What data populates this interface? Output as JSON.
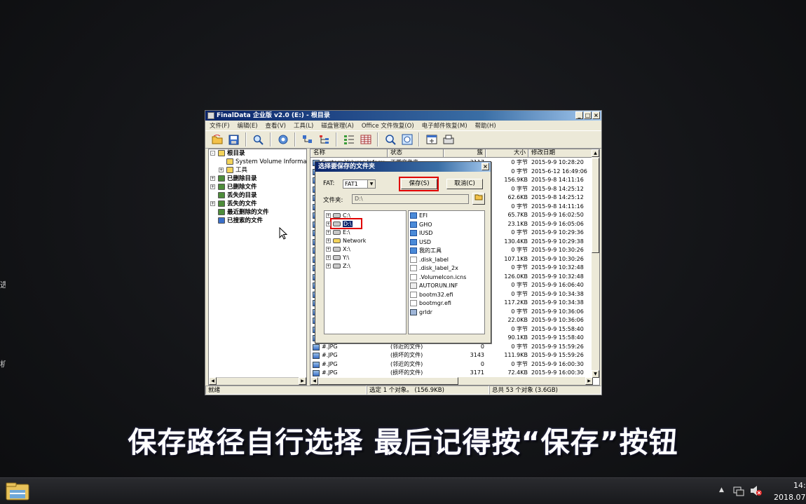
{
  "edge_labels": [
    "选",
    "机"
  ],
  "window": {
    "title": "FinalData 企业版 v2.0 (E:) - 根目录",
    "buttons": [
      "_",
      "□",
      "×"
    ]
  },
  "menu": [
    "文件(F)",
    "编辑(E)",
    "查看(V)",
    "工具(L)",
    "磁盘管理(A)",
    "Office 文件恢复(O)",
    "电子邮件恢复(M)",
    "帮助(H)"
  ],
  "toolbar_icons": [
    "open-folder-icon",
    "save-icon",
    "search-icon",
    "settings-icon",
    "copy-icon",
    "tree-icon",
    "list-view-icon",
    "grid-view-icon",
    "find-icon",
    "compare-icon",
    "add-window-icon",
    "scan-icon"
  ],
  "tree": [
    {
      "label": "根目录",
      "bold": true,
      "indent": 0,
      "exp": "-",
      "icon": "folder"
    },
    {
      "label": "System Volume Information",
      "bold": false,
      "indent": 1,
      "exp": "",
      "icon": "folder"
    },
    {
      "label": "工具",
      "bold": false,
      "indent": 1,
      "exp": "+",
      "icon": "folder"
    },
    {
      "label": "已删除目录",
      "bold": true,
      "indent": 0,
      "exp": "+",
      "icon": "deleted"
    },
    {
      "label": "已删除文件",
      "bold": true,
      "indent": 0,
      "exp": "+",
      "icon": "deleted"
    },
    {
      "label": "丢失的目录",
      "bold": true,
      "indent": 0,
      "exp": "",
      "icon": "deleted"
    },
    {
      "label": "丢失的文件",
      "bold": true,
      "indent": 0,
      "exp": "+",
      "icon": "deleted"
    },
    {
      "label": "最近删除的文件",
      "bold": true,
      "indent": 0,
      "exp": "",
      "icon": "deleted"
    },
    {
      "label": "已搜索的文件",
      "bold": true,
      "indent": 0,
      "exp": "",
      "icon": "search"
    }
  ],
  "list": {
    "columns": [
      "名称",
      "状态",
      "簇",
      "大小",
      "修改日期"
    ],
    "rows": [
      {
        "name": "System Volume Informa",
        "status": "正常文件夹",
        "cluster": "3117",
        "size": "0 字节",
        "date": "2015-9-9 10:28:20"
      },
      {
        "name": "",
        "status": "",
        "cluster": "",
        "size": "0 字节",
        "date": "2015-6-12 16:49:06"
      },
      {
        "name": "",
        "status": "",
        "cluster": "",
        "size": "156.9KB",
        "date": "2015-9-8 14:11:16"
      },
      {
        "name": "",
        "status": "",
        "cluster": "",
        "size": "0 字节",
        "date": "2015-9-8 14:25:12"
      },
      {
        "name": "",
        "status": "",
        "cluster": "",
        "size": "62.6KB",
        "date": "2015-9-8 14:25:12"
      },
      {
        "name": "",
        "status": "",
        "cluster": "",
        "size": "0 字节",
        "date": "2015-9-8 14:11:16"
      },
      {
        "name": "",
        "status": "",
        "cluster": "",
        "size": "65.7KB",
        "date": "2015-9-9 16:02:50"
      },
      {
        "name": "",
        "status": "",
        "cluster": "",
        "size": "23.1KB",
        "date": "2015-9-9 16:05:06"
      },
      {
        "name": "",
        "status": "",
        "cluster": "",
        "size": "0 字节",
        "date": "2015-9-9 10:29:36"
      },
      {
        "name": "",
        "status": "",
        "cluster": "",
        "size": "130.4KB",
        "date": "2015-9-9 10:29:38"
      },
      {
        "name": "",
        "status": "",
        "cluster": "",
        "size": "0 字节",
        "date": "2015-9-9 10:30:26"
      },
      {
        "name": "",
        "status": "",
        "cluster": "",
        "size": "107.1KB",
        "date": "2015-9-9 10:30:26"
      },
      {
        "name": "",
        "status": "",
        "cluster": "",
        "size": "0 字节",
        "date": "2015-9-9 10:32:48"
      },
      {
        "name": "",
        "status": "",
        "cluster": "",
        "size": "126.0KB",
        "date": "2015-9-9 10:32:48"
      },
      {
        "name": "",
        "status": "",
        "cluster": "",
        "size": "0 字节",
        "date": "2015-9-9 16:06:40"
      },
      {
        "name": "",
        "status": "",
        "cluster": "",
        "size": "0 字节",
        "date": "2015-9-9 10:34:38"
      },
      {
        "name": "",
        "status": "",
        "cluster": "",
        "size": "117.2KB",
        "date": "2015-9-9 10:34:38"
      },
      {
        "name": "",
        "status": "",
        "cluster": "",
        "size": "0 字节",
        "date": "2015-9-9 10:36:06"
      },
      {
        "name": "",
        "status": "",
        "cluster": "",
        "size": "22.0KB",
        "date": "2015-9-9 10:36:06"
      },
      {
        "name": "",
        "status": "",
        "cluster": "",
        "size": "0 字节",
        "date": "2015-9-9 15:58:40"
      },
      {
        "name": "",
        "status": "",
        "cluster": "",
        "size": "90.1KB",
        "date": "2015-9-9 15:58:40"
      },
      {
        "name": "#.JPG",
        "status": "(邻近的文件)",
        "cluster": "0",
        "size": "0 字节",
        "date": "2015-9-9 15:59:26"
      },
      {
        "name": "#.JPG",
        "status": "(损坏的文件)",
        "cluster": "3143",
        "size": "111.9KB",
        "date": "2015-9-9 15:59:26"
      },
      {
        "name": "#.JPG",
        "status": "(邻近的文件)",
        "cluster": "0",
        "size": "0 字节",
        "date": "2015-9-9 16:00:30"
      },
      {
        "name": "#.JPG",
        "status": "(损坏的文件)",
        "cluster": "3171",
        "size": "72.4KB",
        "date": "2015-9-9 16:00:30"
      }
    ]
  },
  "status": {
    "ready": "就绪",
    "selection": "选定 1 个对象。 (156.9KB)",
    "total": "总共 53 个对象 (3.6GB)"
  },
  "dialog": {
    "title": "选择要保存的文件夹",
    "close": "×",
    "fat_label": "FAT:",
    "fat_value": "FAT1",
    "save_button": "保存(S)",
    "cancel_button": "取消(C)",
    "folder_label": "文件夹:",
    "folder_value": "D:\\",
    "drives": [
      "C:\\",
      "D:\\",
      "E:\\",
      "Network",
      "X:\\",
      "Y:\\",
      "Z:\\"
    ],
    "files": [
      {
        "name": "EFI",
        "type": "folder"
      },
      {
        "name": "GHO",
        "type": "folder"
      },
      {
        "name": "IUSD",
        "type": "folder"
      },
      {
        "name": "USD",
        "type": "folder"
      },
      {
        "name": "我的工具",
        "type": "folder"
      },
      {
        "name": ".disk_label",
        "type": "file"
      },
      {
        "name": ".disk_label_2x",
        "type": "file"
      },
      {
        "name": ".VolumeIcon.icns",
        "type": "file"
      },
      {
        "name": "AUTORUN.INF",
        "type": "inf"
      },
      {
        "name": "bootm32.efi",
        "type": "file"
      },
      {
        "name": "bootmgr.efi",
        "type": "file"
      },
      {
        "name": "grldr",
        "type": "app"
      }
    ]
  },
  "subtitle": "保存路径自行选择 最后记得按“保存”按钮",
  "taskbar": {
    "clock_time": "14:",
    "clock_date": "2018.07"
  },
  "colors": {
    "highlight_red": "#e00000",
    "titlebar_blue": "#0a246a",
    "folder_yellow": "#f3d35a"
  }
}
